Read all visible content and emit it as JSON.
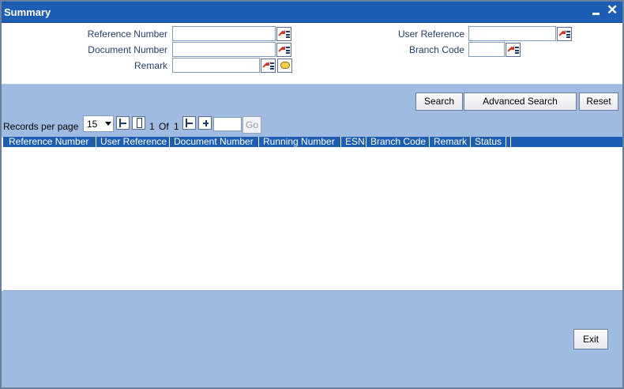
{
  "window": {
    "title": "Summary"
  },
  "form": {
    "reference_number": {
      "label": "Reference Number",
      "value": ""
    },
    "document_number": {
      "label": "Document Number",
      "value": ""
    },
    "remark": {
      "label": "Remark",
      "value": ""
    },
    "user_reference": {
      "label": "User Reference",
      "value": ""
    },
    "branch_code": {
      "label": "Branch Code",
      "value": ""
    }
  },
  "actions": {
    "search": "Search",
    "advanced_search": "Advanced Search",
    "reset": "Reset"
  },
  "pager": {
    "records_label": "Records per page",
    "records_value": "15",
    "current_page": "1",
    "of_label": "Of",
    "total_pages": "1",
    "page_input": "",
    "go": "Go"
  },
  "table": {
    "columns": [
      "Reference Number",
      "User Reference",
      "Document Number",
      "Running Number",
      "ESN",
      "Branch Code",
      "Remark",
      "Status"
    ],
    "rows": []
  },
  "footer": {
    "exit": "Exit"
  },
  "icons": {
    "minimize": "minimize-icon",
    "close": "close-icon",
    "lov": "list-of-values-icon",
    "remark": "comment-bubble-icon"
  }
}
